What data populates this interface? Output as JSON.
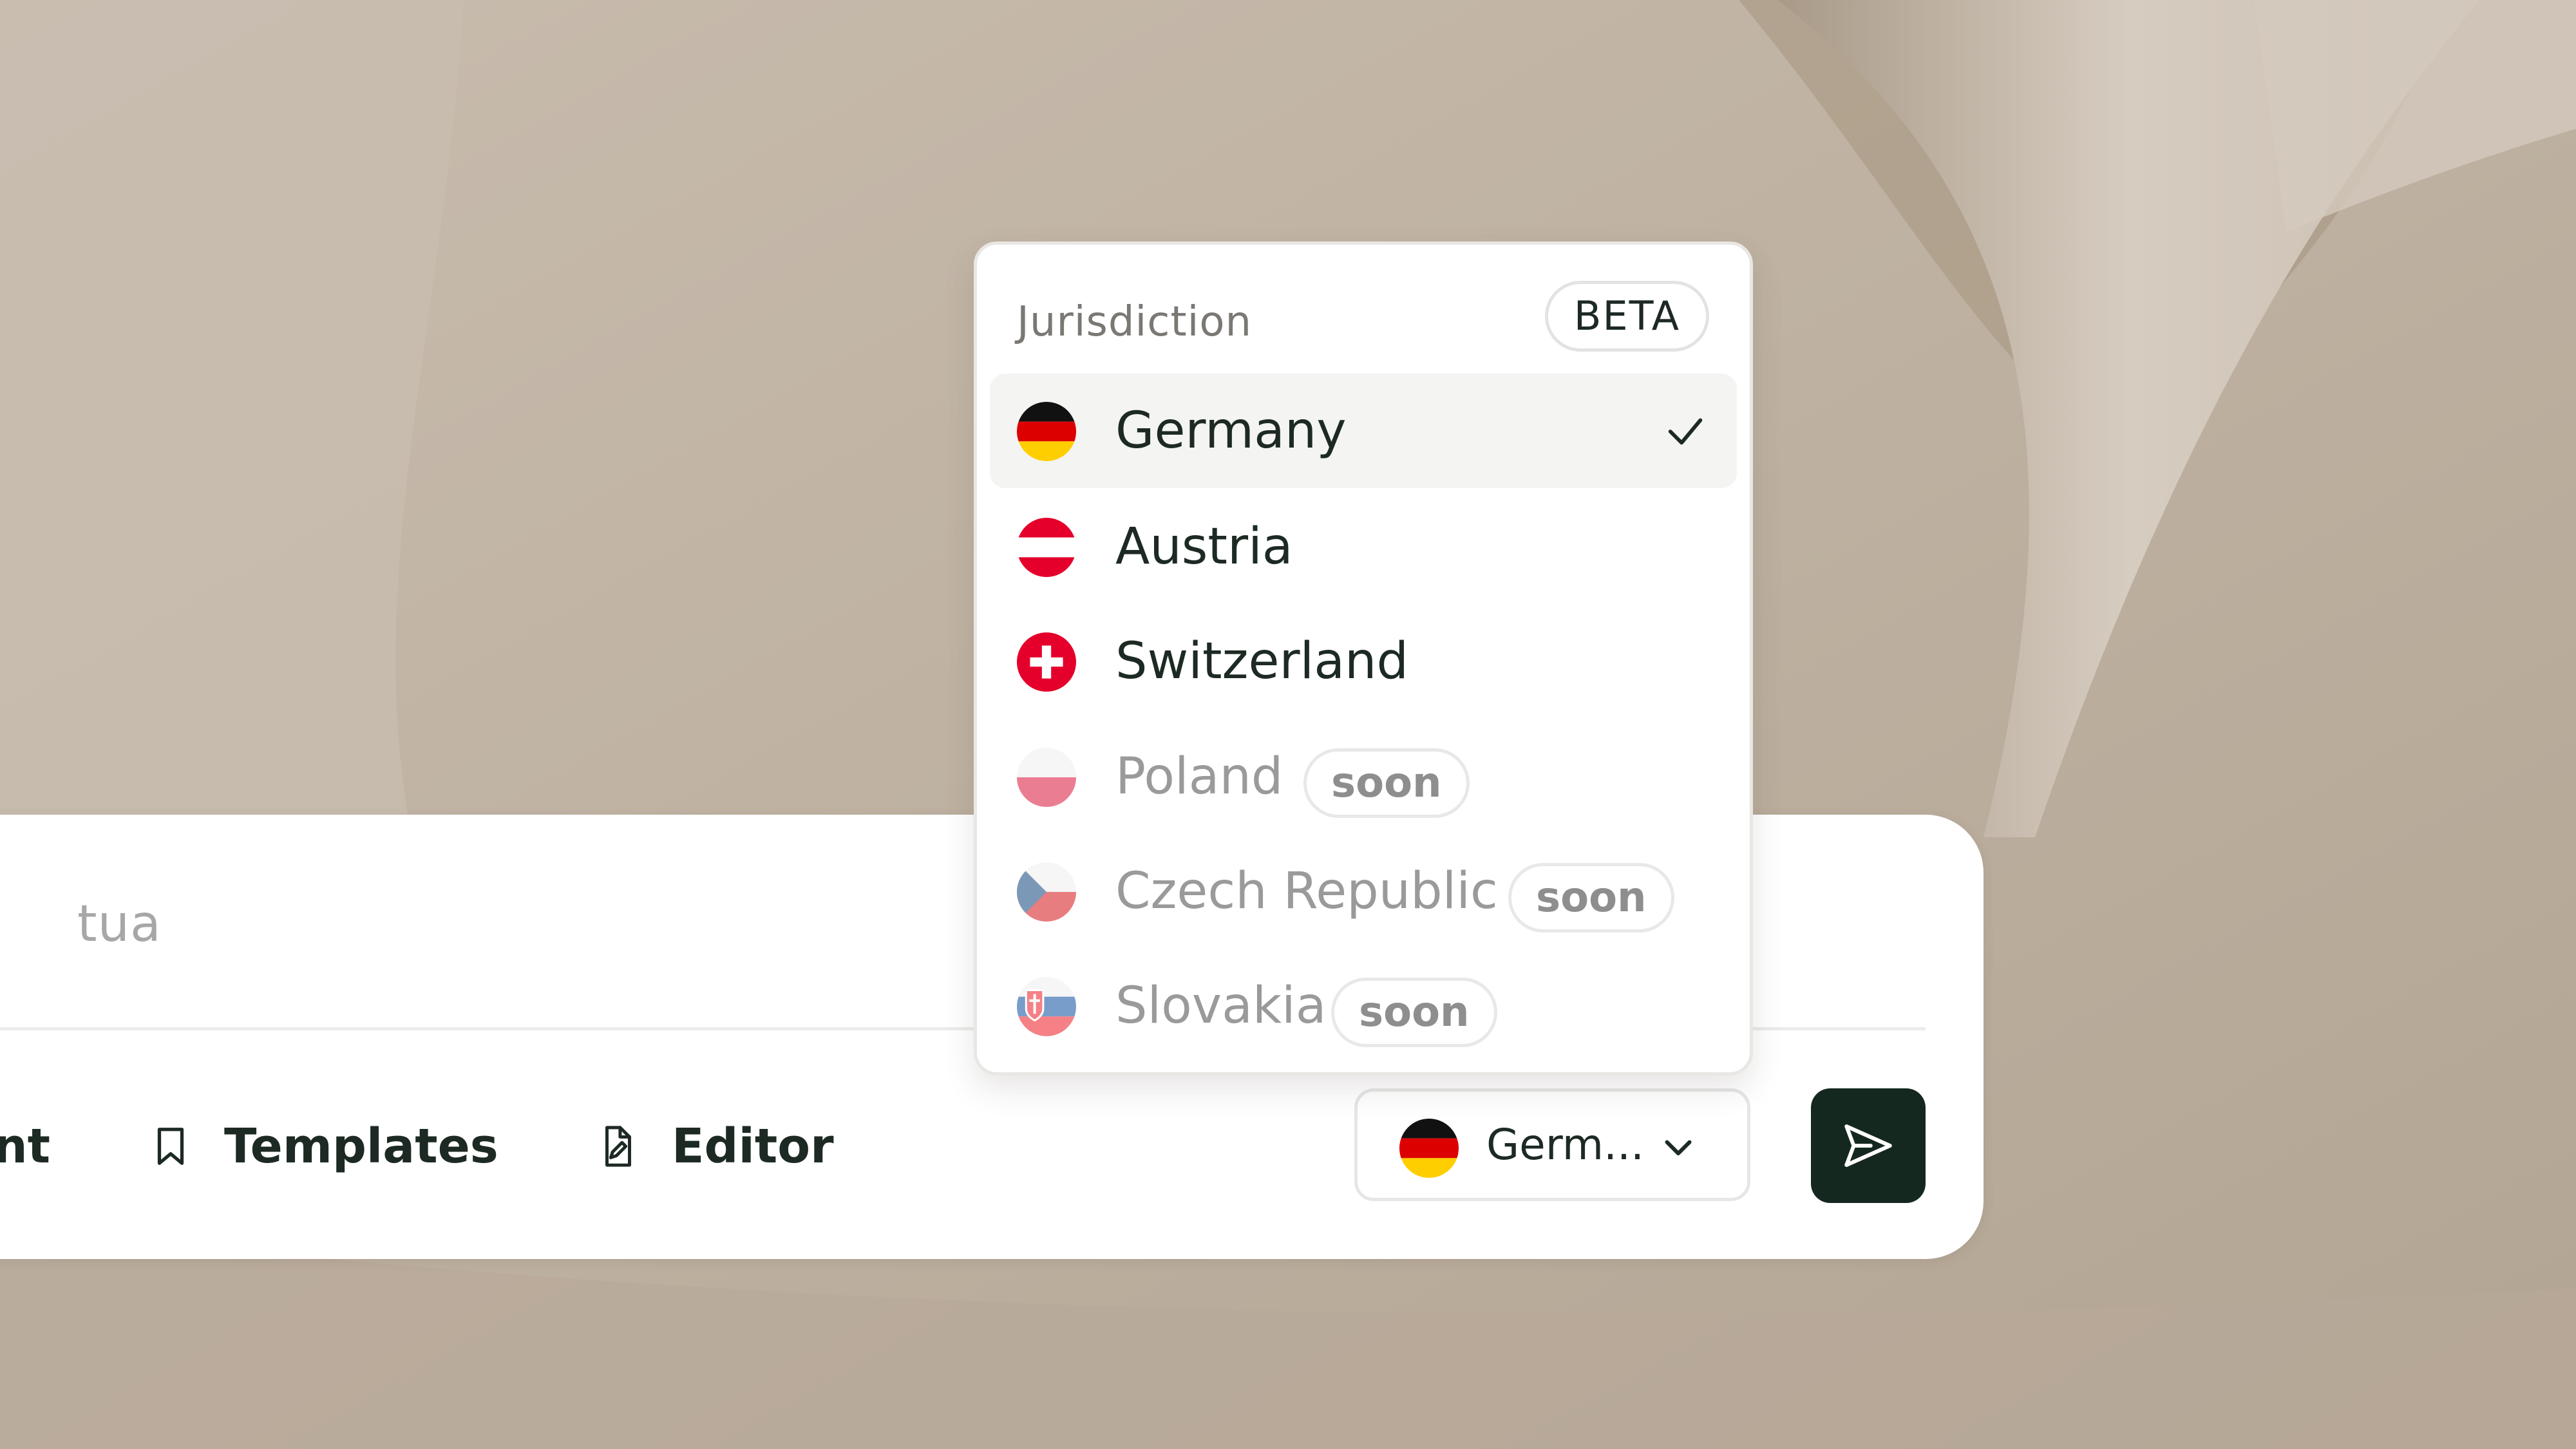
{
  "composer": {
    "prompt_text": "tua",
    "tool_partial_label": "nt",
    "tools": [
      {
        "label": "Templates",
        "icon": "bookmark-icon"
      },
      {
        "label": "Editor",
        "icon": "file-edit-icon"
      }
    ],
    "jurisdiction_select": {
      "value": "Germ...",
      "flag": "germany-flag-icon"
    },
    "send_icon": "send-icon"
  },
  "dropdown": {
    "title": "Jurisdiction",
    "badge": "BETA",
    "options": [
      {
        "label": "Germany",
        "flag": "germany-flag-icon",
        "selected": true,
        "available": true
      },
      {
        "label": "Austria",
        "flag": "austria-flag-icon",
        "selected": false,
        "available": true
      },
      {
        "label": "Switzerland",
        "flag": "switzerland-flag-icon",
        "selected": false,
        "available": true
      },
      {
        "label": "Poland",
        "flag": "poland-flag-icon",
        "selected": false,
        "available": false,
        "badge": "soon"
      },
      {
        "label": "Czech Republic",
        "flag": "czech-flag-icon",
        "selected": false,
        "available": false,
        "badge": "soon"
      },
      {
        "label": "Slovakia",
        "flag": "slovakia-flag-icon",
        "selected": false,
        "available": false,
        "badge": "soon"
      }
    ]
  },
  "colors": {
    "background": "#b9ab9b",
    "panel": "#ffffff",
    "text_dark": "#1d2a23",
    "send_button": "#14281f",
    "muted_text": "#9a9a9a"
  }
}
